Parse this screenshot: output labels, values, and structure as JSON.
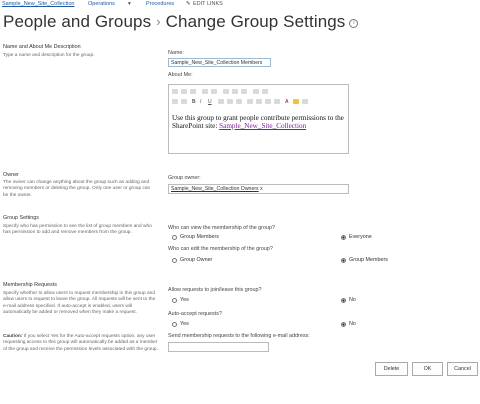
{
  "topnav": {
    "site": "Sample_New_Site_Collection",
    "operations": "Operations",
    "operations_caret": "▾",
    "procedures": "Procedures",
    "edit_links": "EDIT LINKS"
  },
  "title": {
    "main": "People and Groups",
    "separator": "›",
    "sub": "Change Group Settings",
    "info": "i"
  },
  "name_section": {
    "heading": "Name and About Me Description",
    "description": "Type a name and description for the group.",
    "name_label": "Name:",
    "name_value": "Sample_New_Site_Collection Members",
    "about_label": "About Me:",
    "about_text": "Use this group to grant people contribute permissions to the SharePoint site: ",
    "about_link": "Sample_New_Site_Collection"
  },
  "owner_section": {
    "heading": "Owner",
    "description": "The owner can change anything about the group such as adding and removing members or deleting the group. Only one user or group can be the owner.",
    "label": "Group owner:",
    "value": "Sample_New_Site_Collection Owners",
    "remove": "x"
  },
  "group_settings": {
    "heading": "Group Settings",
    "description": "Specify who has permission to see the list of group members and who has permission to add and remove members from the group.",
    "view_question": "Who can view the membership of the group?",
    "view_options": [
      "Group Members",
      "Everyone"
    ],
    "edit_question": "Who can edit the membership of the group?",
    "edit_options": [
      "Group Owner",
      "Group Members"
    ]
  },
  "membership": {
    "heading": "Membership Requests",
    "description": "Specify whether to allow users to request membership in this group and allow users to request to leave the group. All requests will be sent to the e-mail address specified. If auto-accept is enabled, users will automatically be added or removed when they make a request.",
    "caution_label": "Caution:",
    "caution_text": " If you select Yes for the Auto-accept requests option, any user requesting access to this group will automatically be added as a member of the group and receive the permission levels associated with the group.",
    "allow_question": "Allow requests to join/leave this group?",
    "allow_options": [
      "Yes",
      "No"
    ],
    "auto_question": "Auto-accept requests?",
    "auto_options": [
      "Yes",
      "No"
    ],
    "email_label": "Send membership requests to the following e-mail address:",
    "email_value": ""
  },
  "buttons": {
    "delete": "Delete",
    "ok": "OK",
    "cancel": "Cancel"
  },
  "selected": {
    "view": "Everyone",
    "edit": "Group Members",
    "allow": "No",
    "auto": "No"
  }
}
